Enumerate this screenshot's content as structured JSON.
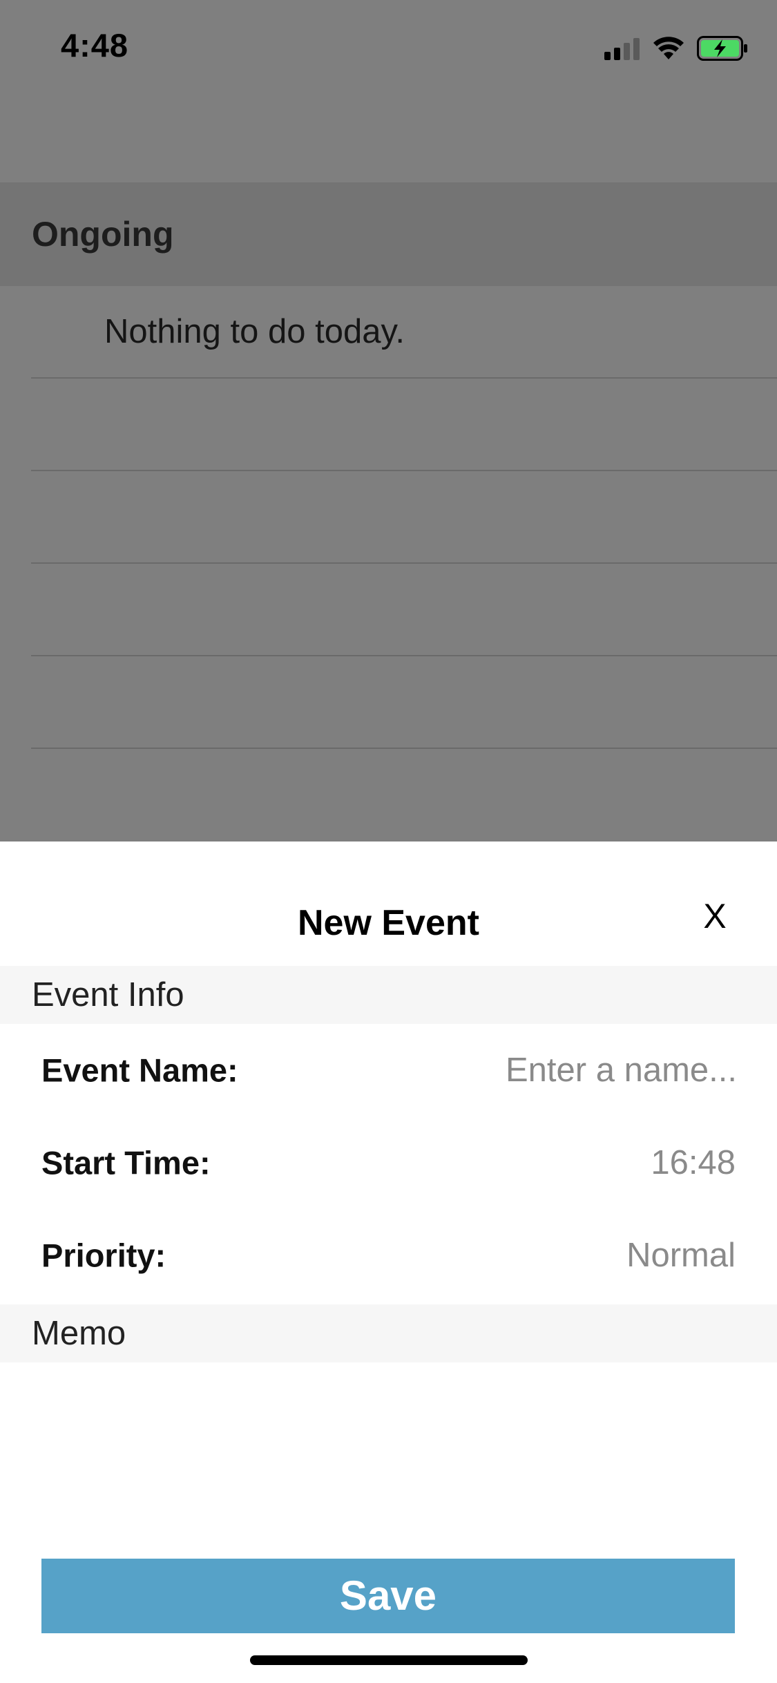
{
  "status_bar": {
    "time": "4:48",
    "icons": [
      "cellular-signal-icon",
      "wifi-icon",
      "battery-charging-icon"
    ],
    "battery_color": "#4cd964"
  },
  "background": {
    "section_title": "Ongoing",
    "empty_message": "Nothing to do today."
  },
  "modal": {
    "title": "New Event",
    "close_label": "X",
    "event_info_header": "Event Info",
    "fields": {
      "event_name": {
        "label": "Event Name:",
        "value": "",
        "placeholder": "Enter a name..."
      },
      "start_time": {
        "label": "Start Time:",
        "value": "16:48"
      },
      "priority": {
        "label": "Priority:",
        "value": "Normal"
      }
    },
    "memo_header": "Memo",
    "save_label": "Save",
    "save_color": "#56a2c8"
  }
}
